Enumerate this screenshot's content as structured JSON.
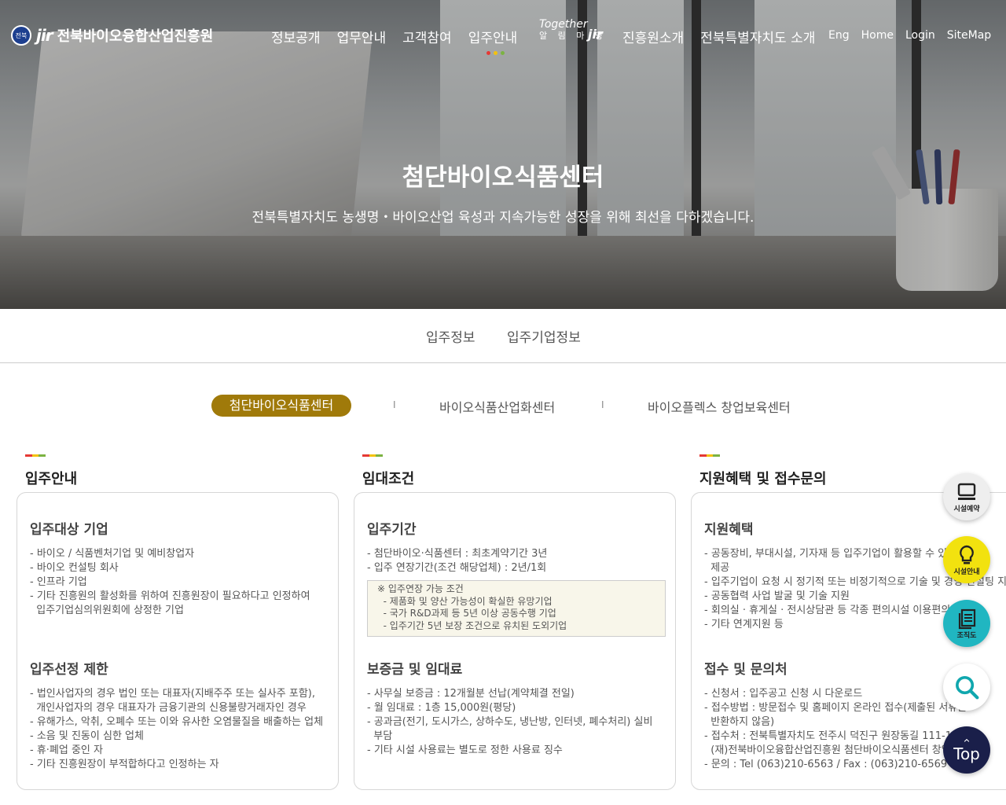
{
  "header": {
    "org_name": "전북바이오융합산업진흥원",
    "logo_mark": "jir",
    "seal_text": "전북",
    "menu_left": [
      "정보공개",
      "업무안내",
      "고객참여",
      "입주안내"
    ],
    "together": {
      "line1": "Together",
      "line2": "알 림 마 당",
      "mark": "jir"
    },
    "menu_right": [
      "진흥원소개",
      "전북특별자치도 소개"
    ],
    "util": [
      "Eng",
      "Home",
      "Login",
      "SiteMap"
    ],
    "dot_colors": [
      "#e53935",
      "#f4c20d",
      "#7cb342"
    ]
  },
  "hero": {
    "title": "첨단바이오식품센터",
    "subtitle": "전북특별자치도 농생명・바이오산업 육성과 지속가능한 성장을 위해 최선을 다하겠습니다."
  },
  "subnav": [
    "입주정보",
    "입주기업정보"
  ],
  "center_tabs": {
    "active": "첨단바이오식품센터",
    "others": [
      "바이오식품산업화센터",
      "바이오플렉스 창업보육센터"
    ],
    "separator": "I",
    "accent": "#a07a0a"
  },
  "columns": [
    {
      "title": "입주안내",
      "sections": [
        {
          "heading": "입주대상 기업",
          "lines": [
            "- 바이오 / 식품벤처기업 및 예비창업자",
            "- 바이오 컨설팅 회사",
            "- 인프라 기업",
            "- 기타 진흥원의 활성화를 위하여 진흥원장이 필요하다고 인정하여",
            "  입주기업심의위원회에 상정한 기업"
          ]
        },
        {
          "heading": "입주선정 제한",
          "lines": [
            "- 법인사업자의 경우 법인 또는 대표자(지배주주 또는 실사주 포함),",
            "  개인사업자의 경우 대표자가 금융기관의 신용불량거래자인 경우",
            "- 유해가스, 악취, 오폐수 또는 이와 유사한 오염물질을 배출하는 업체",
            "- 소음 및 진동이 심한 업체",
            "- 휴·폐업 중인 자",
            "- 기타 진흥원장이 부적합하다고 인정하는 자"
          ]
        }
      ]
    },
    {
      "title": "임대조건",
      "sections": [
        {
          "heading": "입주기간",
          "lines": [
            "- 첨단바이오·식품센터 : 최초계약기간 3년",
            "- 입주 연장기간(조건 해당업체) : 2년/1회"
          ]
        },
        {
          "heading": "보증금 및 임대료",
          "lines": [
            "- 사무실 보증금 : 12개월분 선납(계약체결 전일)",
            "- 월 임대료 : 1층 15,000원(평당)",
            "- 공과금(전기, 도시가스, 상하수도, 냉난방, 인터넷, 폐수처리) 실비",
            "  부담",
            "- 기타 시설 사용료는 별도로 정한 사용료 징수"
          ]
        }
      ],
      "note": [
        "※ 입주연장 가능 조건",
        "  - 제품화 및 양산 가능성이 확실한 유망기업",
        "  - 국가 R&D과제 등 5년 이상 공동수행 기업",
        "  - 입주기간 5년 보장 조건으로 유치된 도외기업"
      ]
    },
    {
      "title": "지원혜택 및 접수문의",
      "sections": [
        {
          "heading": "지원혜택",
          "lines": [
            "- 공동장비, 부대시설, 기자재 등 입주기업이 활용할 수 있도록",
            "  제공",
            "- 입주기업이 요청 시 정기적 또는 비정기적으로 기술 및 경영 컨설팅 지원",
            "- 공동협력 사업 발굴 및 기술 지원",
            "- 회의실 · 휴게실 · 전시상담관 등 각종 편의시설 이용편의 제공",
            "- 기타 연계지원 등"
          ]
        },
        {
          "heading": "접수 및 문의처",
          "lines": [
            "- 신청서 : 입주공고 신청 시 다운로드",
            "- 접수방법 : 방문접수 및 홈페이지 온라인 접수(제출된 서류는",
            "  반환하지 않음)",
            "- 접수처 : 전북특별자치도 전주시 덕진구 원장동길 111-18",
            "  (재)전북바이오융합산업진흥원 첨단바이오식품센터 창업보육실",
            "- 문의 : Tel (063)210-6563 / Fax : (063)210-6569"
          ]
        }
      ]
    }
  ],
  "quick": [
    {
      "label": "시설예약",
      "icon": "monitor-icon",
      "bg": "#eeeeee"
    },
    {
      "label": "시설안내",
      "icon": "lightbulb-icon",
      "bg": "#f2e20f"
    },
    {
      "label": "조직도",
      "icon": "document-icon",
      "bg": "#20b6c1"
    },
    {
      "label": "",
      "icon": "search-icon",
      "bg": "#ffffff"
    },
    {
      "label": "Top",
      "icon": "chevron-up-icon",
      "bg": "#1a1f4a"
    }
  ]
}
